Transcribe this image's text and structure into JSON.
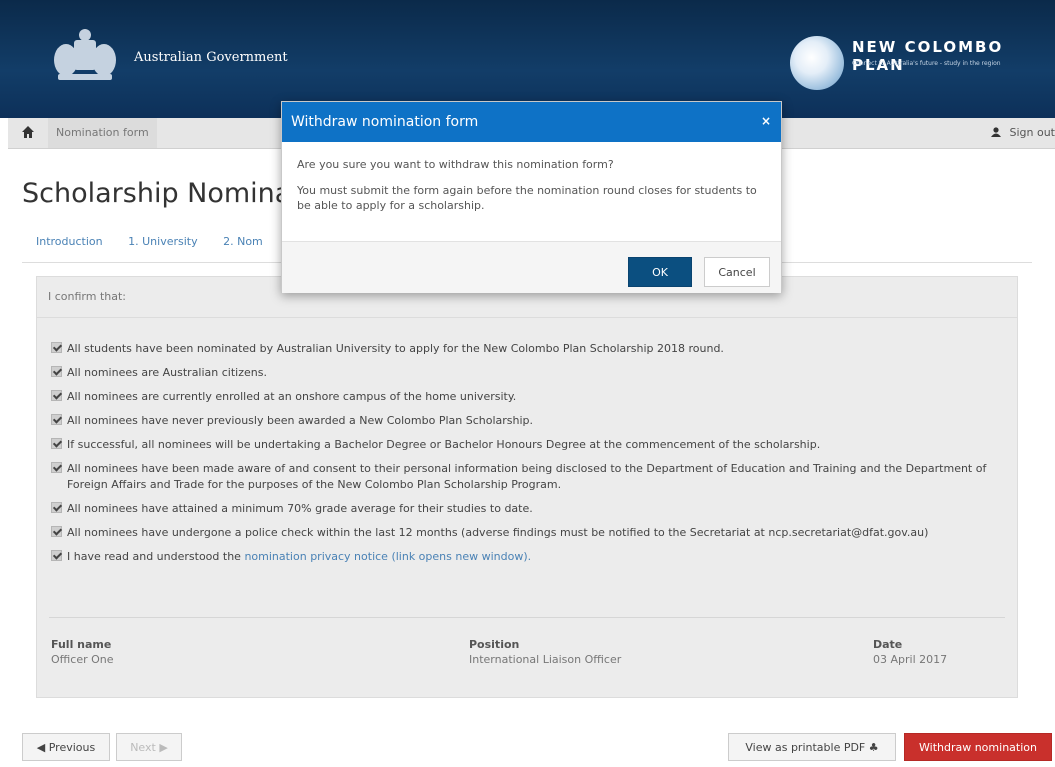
{
  "header": {
    "gov_title": "Australian Government",
    "ncp_title": "NEW COLOMBO PLAN",
    "ncp_tagline": "Connect to Australia's future - study in the region"
  },
  "nav": {
    "breadcrumb": "Nomination form",
    "signout": "Sign out"
  },
  "page": {
    "title": "Scholarship Nomina",
    "tabs": [
      "Introduction",
      "1. University",
      "2. Nom"
    ],
    "panel_heading": "I confirm that:",
    "confirmations": [
      "All students have been nominated by Australian University to apply for the New Colombo Plan Scholarship 2018 round.",
      "All nominees are Australian citizens.",
      "All nominees are currently enrolled at an onshore campus of the home university.",
      "All nominees have never previously been awarded a New Colombo Plan Scholarship.",
      "If successful, all nominees will be undertaking a Bachelor Degree or Bachelor Honours Degree at the commencement of the scholarship.",
      "All nominees have been made aware of and consent to their personal information being disclosed to the Department of Education and Training and the Department of Foreign Affairs and Trade for the purposes of the New Colombo Plan Scholarship Program.",
      "All nominees have attained a minimum 70% grade average for their studies to date.",
      "All nominees have undergone a police check within the last 12 months (adverse findings must be notified to the Secretariat at ncp.secretariat@dfat.gov.au)"
    ],
    "privacy_prefix": "I have read and understood the ",
    "privacy_link": "nomination privacy notice (link opens new window).",
    "fields": {
      "full_name_label": "Full name",
      "full_name_value": "Officer One",
      "position_label": "Position",
      "position_value": "International Liaison Officer",
      "date_label": "Date",
      "date_value": "03 April 2017"
    }
  },
  "footer": {
    "previous": "Previous",
    "next": "Next",
    "pdf": "View as printable PDF",
    "withdraw": "Withdraw nomination"
  },
  "modal": {
    "title": "Withdraw nomination form",
    "question": "Are you sure you want to withdraw this nomination form?",
    "message": "You must submit the form again before the nomination round closes for students to be able to apply for a scholarship.",
    "ok": "OK",
    "cancel": "Cancel",
    "close_glyph": "×"
  },
  "icons": {
    "home": "home-icon",
    "user": "user-icon",
    "close": "close-icon",
    "pdf": "printer-icon"
  },
  "colors": {
    "header_bg": "#123d68",
    "modal_header": "#0e72c6",
    "ok_button": "#0b4f80",
    "withdraw_button": "#c9302c",
    "link": "#4a82b5"
  }
}
